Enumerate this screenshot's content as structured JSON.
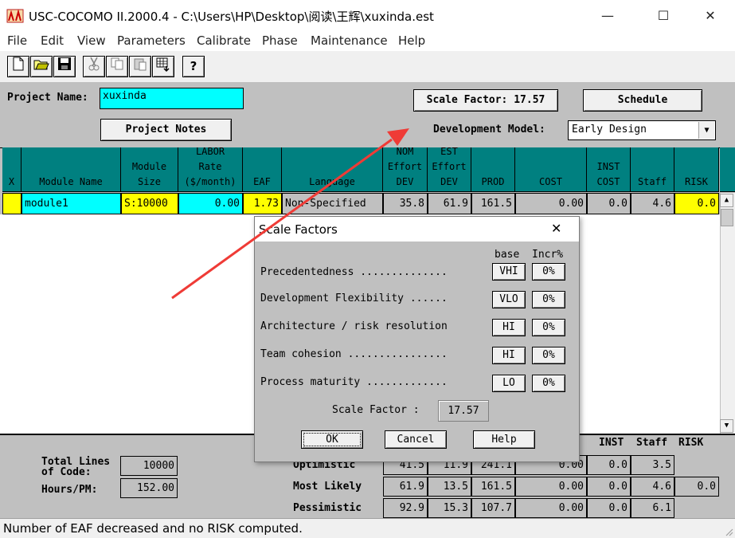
{
  "window": {
    "title": "USC-COCOMO II.2000.4 - C:\\Users\\HP\\Desktop\\阅读\\王辉\\xuxinda.est",
    "minimize": "—",
    "maximize": "☐",
    "close": "✕"
  },
  "menu": [
    "File",
    "Edit",
    "View",
    "Parameters",
    "Calibrate",
    "Phase",
    "Maintenance",
    "Help"
  ],
  "toolbar_icons": [
    "new-file-icon",
    "open-folder-icon",
    "save-icon",
    "cut-icon",
    "copy-icon",
    "paste-icon",
    "export-icon",
    "help-icon"
  ],
  "project": {
    "name_label": "Project Name:",
    "name_value": "xuxinda",
    "notes_button": "Project Notes",
    "scale_factor_button": "Scale Factor: 17.57",
    "schedule_button": "Schedule",
    "dev_model_label": "Development Model:",
    "dev_model_value": "Early Design"
  },
  "table": {
    "headers": [
      {
        "text": "X"
      },
      {
        "text": "Module Name"
      },
      {
        "text": "Module\nSize"
      },
      {
        "text": "LABOR\nRate\n($/month)"
      },
      {
        "text": "EAF"
      },
      {
        "text": "Language"
      },
      {
        "text": "NOM\nEffort\nDEV"
      },
      {
        "text": "EST\nEffort\nDEV"
      },
      {
        "text": "PROD"
      },
      {
        "text": "COST"
      },
      {
        "text": "INST\nCOST"
      },
      {
        "text": "Staff"
      },
      {
        "text": "RISK"
      }
    ],
    "row": {
      "x": "",
      "module_name": "module1",
      "module_size": "S:10000",
      "labor_rate": "0.00",
      "eaf": "1.73",
      "language": "Non-Specified",
      "nom_effort": "35.8",
      "est_effort": "61.9",
      "prod": "161.5",
      "cost": "0.00",
      "inst_cost": "0.0",
      "staff": "4.6",
      "risk": "0.0"
    }
  },
  "summary": {
    "total_lines_label": "Total Lines\nof Code:",
    "total_lines_value": "10000",
    "hours_label": "Hours/PM:",
    "hours_value": "152.00",
    "header_inst": "INST",
    "header_staff": "Staff",
    "header_risk": "RISK",
    "rows": [
      {
        "label": "Optimistic",
        "v1": "41.5",
        "v2": "11.9",
        "v3": "241.1",
        "v4": "0.00",
        "v5": "0.0",
        "v6": "3.5",
        "v7": ""
      },
      {
        "label": "Most Likely",
        "v1": "61.9",
        "v2": "13.5",
        "v3": "161.5",
        "v4": "0.00",
        "v5": "0.0",
        "v6": "4.6",
        "v7": "0.0"
      },
      {
        "label": "Pessimistic",
        "v1": "92.9",
        "v2": "15.3",
        "v3": "107.7",
        "v4": "0.00",
        "v5": "0.0",
        "v6": "6.1",
        "v7": ""
      }
    ]
  },
  "status": "Number of EAF decreased and no RISK computed.",
  "dialog": {
    "title": "Scale Factors",
    "close": "✕",
    "col_base": "base",
    "col_incr": "Incr%",
    "factors": [
      {
        "label": "Precedentedness ..............",
        "base": "VHI",
        "incr": "0%"
      },
      {
        "label": "Development Flexibility ......",
        "base": "VLO",
        "incr": "0%"
      },
      {
        "label": "Architecture / risk resolution",
        "base": "HI",
        "incr": "0%"
      },
      {
        "label": "Team cohesion ................",
        "base": "HI",
        "incr": "0%"
      },
      {
        "label": "Process maturity .............",
        "base": "LO",
        "incr": "0%"
      }
    ],
    "scale_factor_label": "Scale Factor :",
    "scale_factor_value": "17.57",
    "ok": "OK",
    "cancel": "Cancel",
    "help": "Help"
  },
  "colors": {
    "header_teal": "#008080",
    "highlight_yellow": "#ffff00",
    "name_cyan": "#00ffff",
    "panel_gray": "#c0c0c0",
    "annotation_red": "#ef3b36"
  }
}
